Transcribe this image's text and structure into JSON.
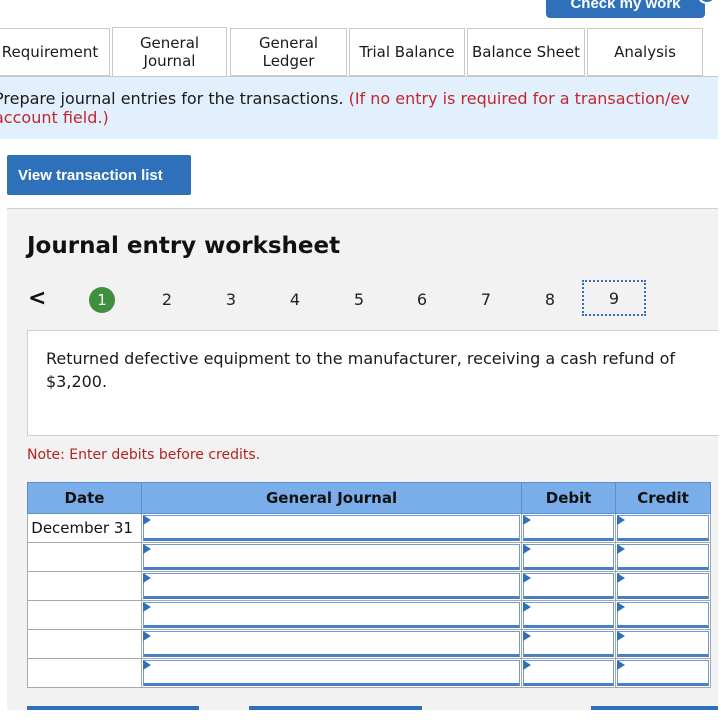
{
  "header": {
    "check_button": "Check my work"
  },
  "tabs": [
    {
      "label": "Requirement"
    },
    {
      "label": "General Journal",
      "line1": "General",
      "line2": "Journal"
    },
    {
      "label": "General Ledger",
      "line1": "General",
      "line2": "Ledger"
    },
    {
      "label": "Trial Balance"
    },
    {
      "label": "Balance Sheet"
    },
    {
      "label": "Analysis"
    }
  ],
  "instructions": {
    "text": "Prepare journal entries for the transactions.",
    "note_line1": "(If no entry is required for a transaction/ev",
    "note_line2": "account field.)"
  },
  "view_button": "View transaction list",
  "worksheet": {
    "title": "Journal entry worksheet",
    "prev_symbol": "<",
    "pages": [
      "1",
      "2",
      "3",
      "4",
      "5",
      "6",
      "7",
      "8",
      "9"
    ],
    "completed_page": "1",
    "current_page": "9",
    "description": "Returned defective equipment to the manufacturer, receiving a cash refund of $3,200.",
    "note": "Note: Enter debits before credits."
  },
  "table": {
    "headers": {
      "date": "Date",
      "journal": "General Journal",
      "debit": "Debit",
      "credit": "Credit"
    },
    "rows": [
      {
        "date": "December 31"
      },
      {
        "date": ""
      },
      {
        "date": ""
      },
      {
        "date": ""
      },
      {
        "date": ""
      },
      {
        "date": ""
      }
    ]
  }
}
